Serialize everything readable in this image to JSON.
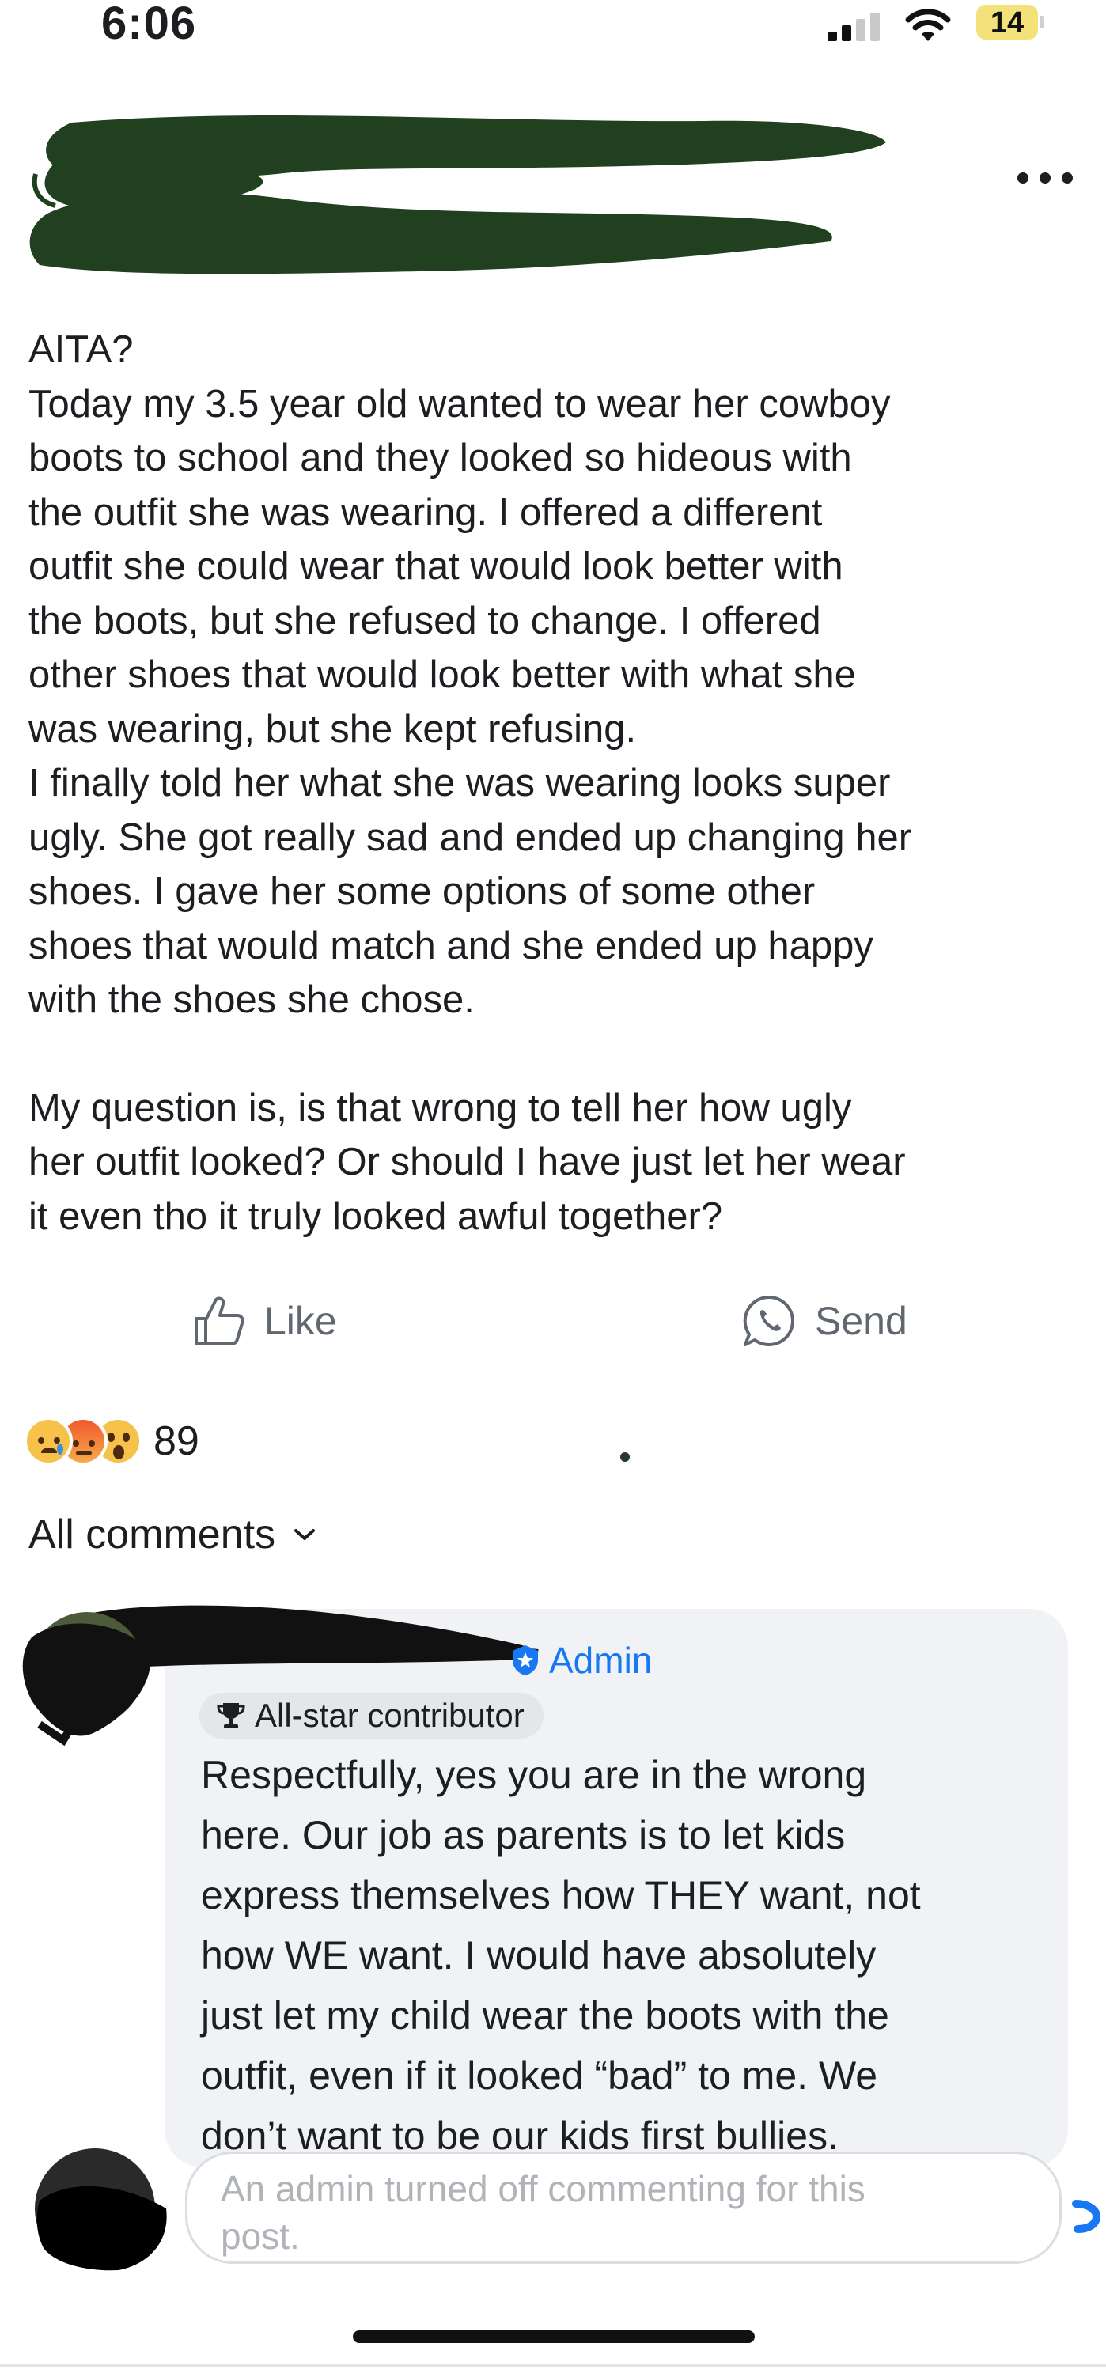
{
  "status_bar": {
    "time": "6:06",
    "battery_level": "14"
  },
  "post": {
    "title": "AITA?",
    "paragraph_1": "Today my 3.5 year old wanted to wear her cowboy\nboots to school and they looked so hideous with\nthe outfit she was wearing. I offered a different\noutfit she could wear that would look better with\nthe boots, but she refused to change. I offered\nother shoes that would look better with what she\nwas wearing, but she kept refusing.\nI finally told her what she was wearing looks super\nugly. She got really sad and ended up changing her\nshoes. I gave her some options of some other\nshoes that would match and she ended up happy\nwith the shoes she chose.",
    "paragraph_2": "My question is, is that wrong to tell her how ugly\nher outfit looked? Or should I have just let her wear\nit even tho it truly looked awful together?"
  },
  "actions": {
    "like_label": "Like",
    "send_label": "Send"
  },
  "reactions": {
    "icons": [
      "sad-emoji",
      "angry-emoji",
      "wow-emoji"
    ],
    "count": "89"
  },
  "comments_filter": {
    "label": "All comments"
  },
  "comment": {
    "role_label": "Admin",
    "badge_label": "All-star contributor",
    "text": "Respectfully, yes you are in the wrong\nhere. Our job as parents is to let kids\nexpress themselves how THEY want, not\nhow WE want. I would have absolutely\njust let my child wear the boots with the\noutfit, even if it looked “bad” to me. We\ndon’t want to be our kids first bullies."
  },
  "composer": {
    "placeholder": "An admin turned off commenting for this\npost."
  },
  "colors": {
    "redaction": "#20401f",
    "accent_blue": "#1877f2",
    "bubble_bg": "#f0f2f5"
  }
}
